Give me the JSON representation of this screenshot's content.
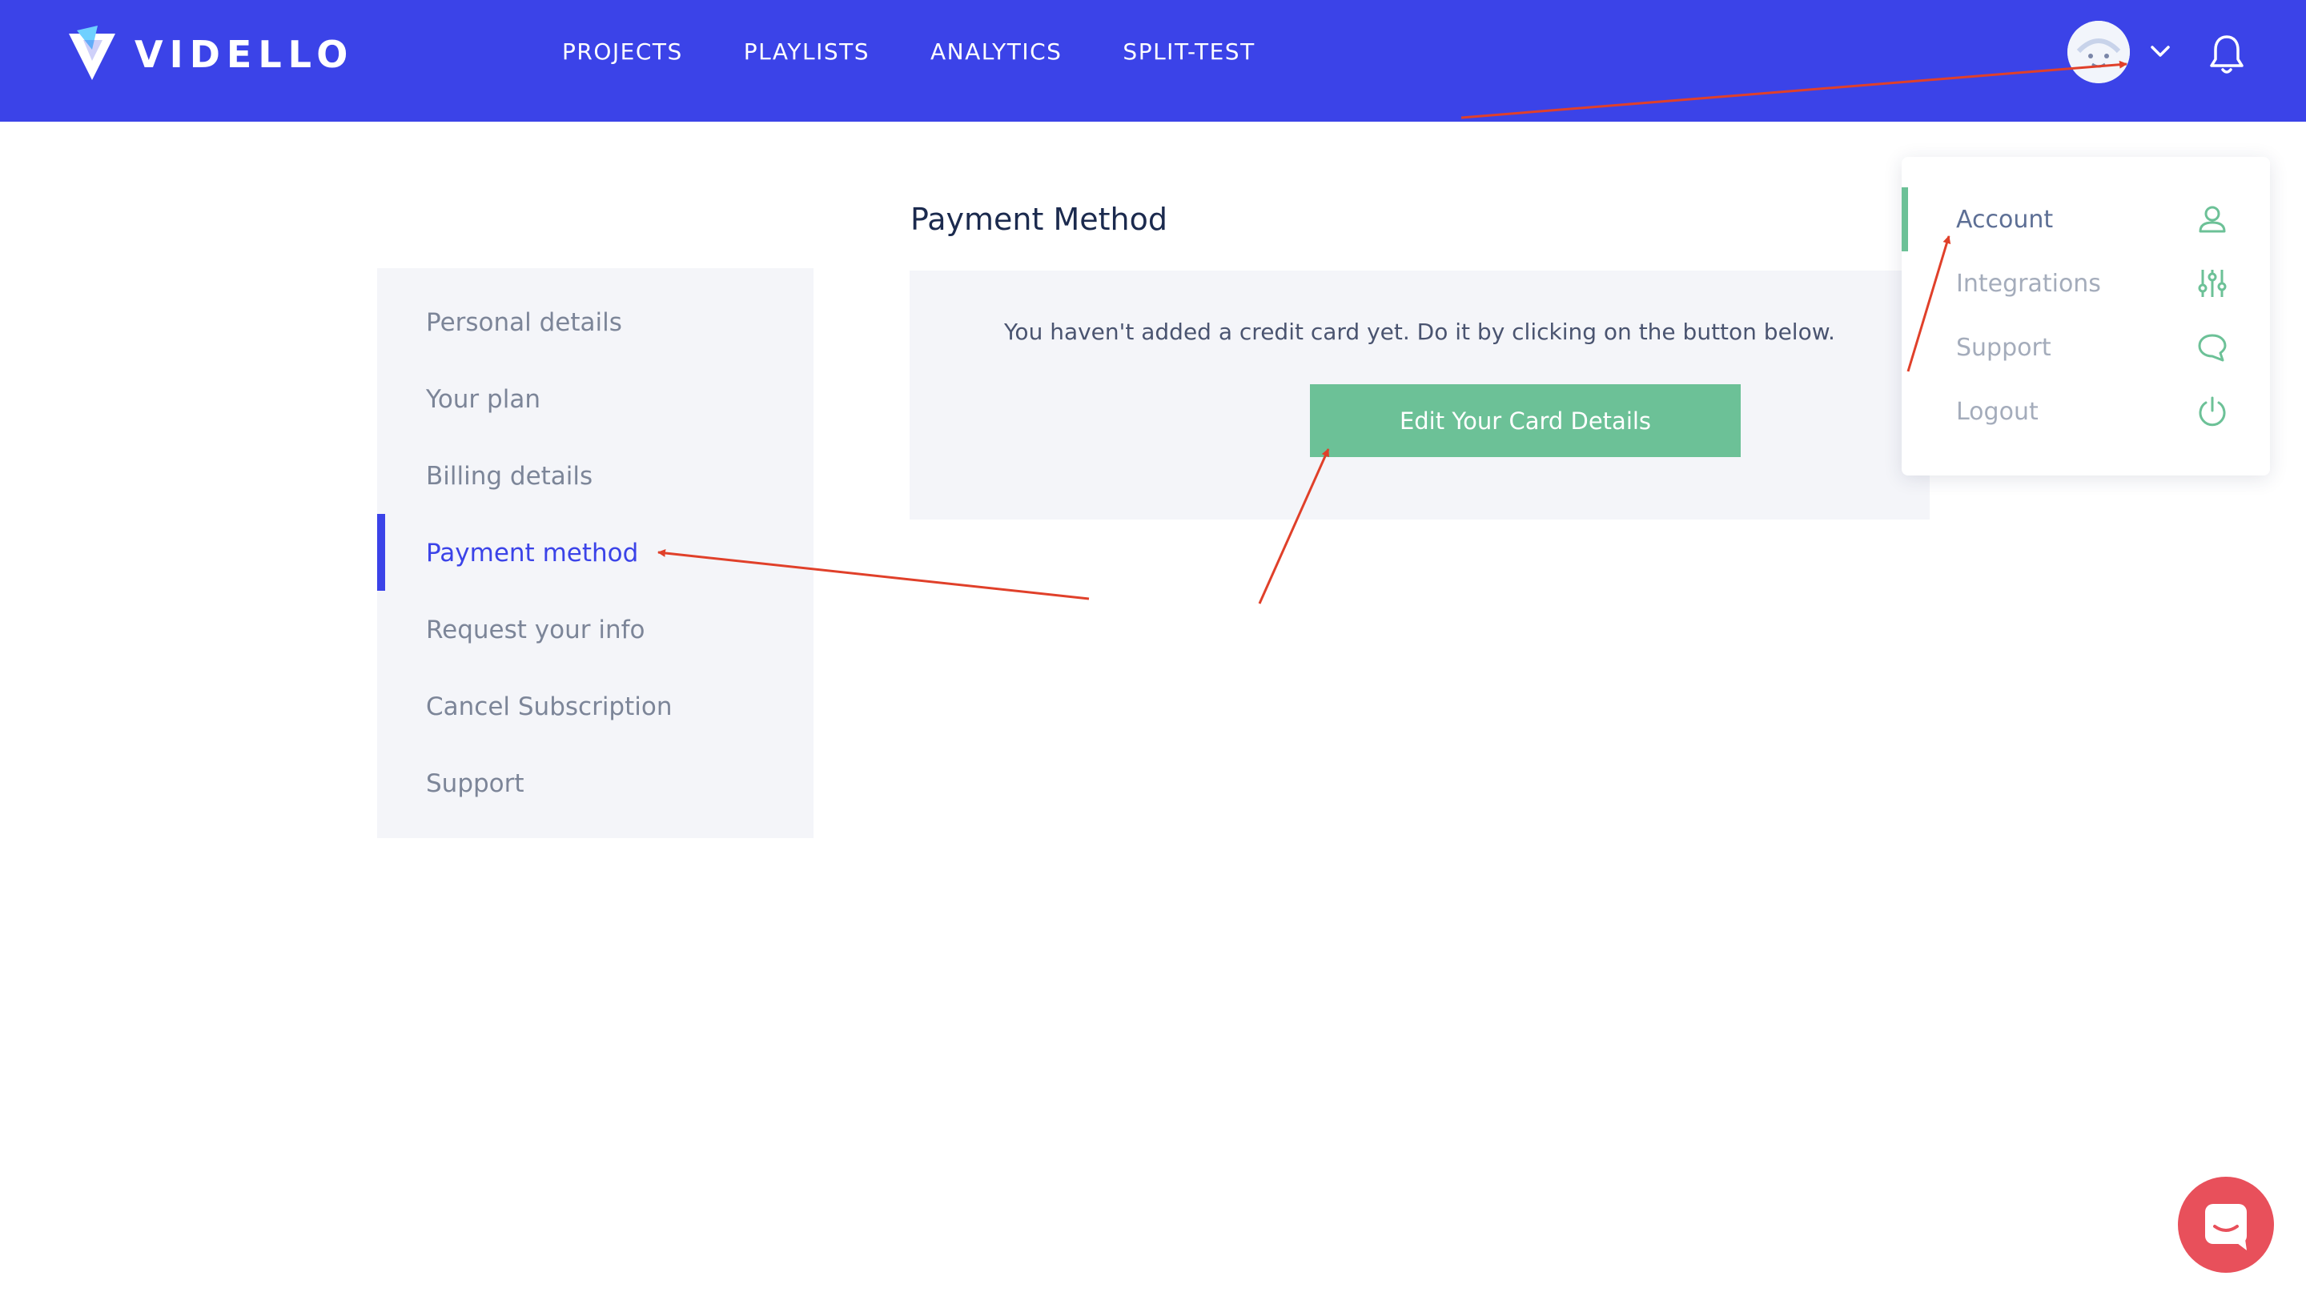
{
  "brand": {
    "name": "VIDELLO"
  },
  "nav": [
    "PROJECTS",
    "PLAYLISTS",
    "ANALYTICS",
    "SPLIT-TEST"
  ],
  "header": {
    "user_menu_icon": "chevron-down-icon",
    "notifications_icon": "bell-icon"
  },
  "sidebar": {
    "items": [
      "Personal details",
      "Your plan",
      "Billing details",
      "Payment method",
      "Request your info",
      "Cancel Subscription",
      "Support"
    ],
    "active": "Payment method"
  },
  "main": {
    "title": "Payment Method",
    "message": "You haven't added a credit card yet. Do it by clicking on the button below.",
    "button": "Edit Your Card Details"
  },
  "dropdown": {
    "items": [
      {
        "label": "Account",
        "icon": "user-icon"
      },
      {
        "label": "Integrations",
        "icon": "sliders-icon"
      },
      {
        "label": "Support",
        "icon": "chat-icon"
      },
      {
        "label": "Logout",
        "icon": "power-icon"
      }
    ]
  },
  "colors": {
    "primary": "#3b43e8",
    "accent": "#6cc197",
    "annotation": "#e0402a",
    "chat": "#e8505b"
  }
}
